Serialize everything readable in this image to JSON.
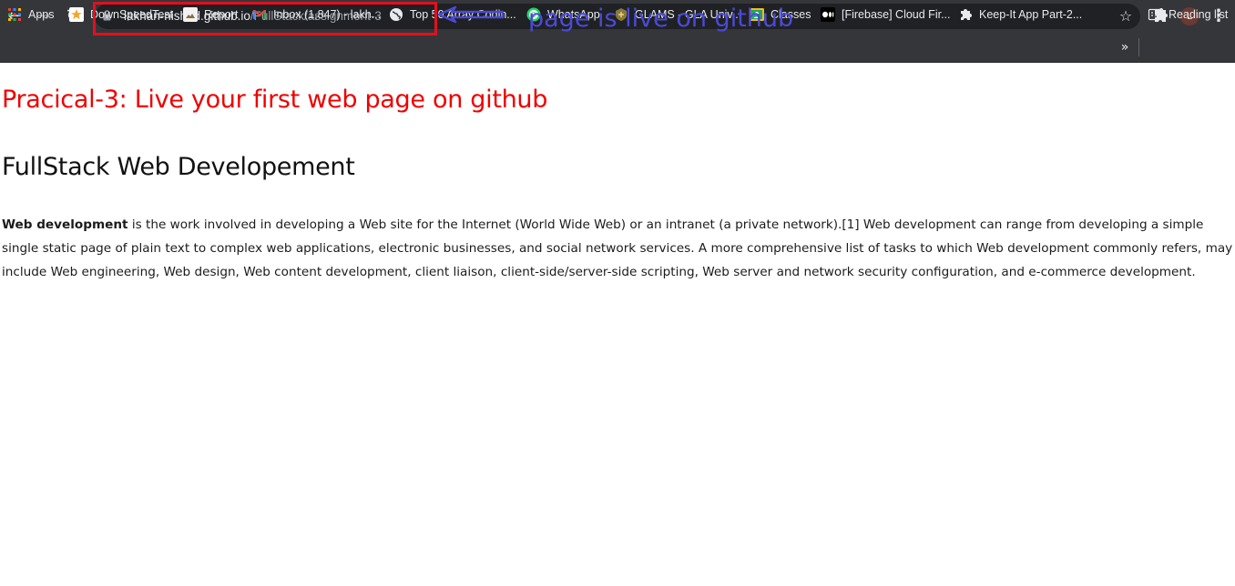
{
  "browser": {
    "url_host": "lakhan-nishad.github.io",
    "url_path": "/FullStack/assignment-3",
    "profile_initial": "L"
  },
  "bookmarks": [
    {
      "label": "Apps",
      "icon": "apps-grid-icon"
    },
    {
      "label": "DownSpeedTest",
      "icon": "downspeedtest-icon"
    },
    {
      "label": "Report",
      "icon": "report-icon"
    },
    {
      "label": "Inbox (1,847) - lakh...",
      "icon": "gmail-icon"
    },
    {
      "label": "Top 50 Array Codin...",
      "icon": "globe-icon"
    },
    {
      "label": "WhatsApp",
      "icon": "whatsapp-icon"
    },
    {
      "label": "GLAMS - GLA Univ...",
      "icon": "gla-icon"
    },
    {
      "label": "Classes",
      "icon": "classroom-icon"
    },
    {
      "label": "[Firebase] Cloud Fir...",
      "icon": "medium-icon"
    },
    {
      "label": "Keep-It App Part-2...",
      "icon": "puzzle-bookmark-icon"
    }
  ],
  "reading_list": "Reading list",
  "annotation": {
    "note": "page is live on github",
    "box_color": "#e1101f",
    "note_color": "#4a4ad6"
  },
  "page": {
    "heading": "Pracical-3: Live your first web page on github",
    "subheading": "FullStack Web Developement",
    "para_bold": "Web development",
    "para_text": " is the work involved in developing a Web site for the Internet (World Wide Web) or an intranet (a private network).[1] Web development can range from developing a simple single static page of plain text to complex web applications, electronic businesses, and social network services. A more comprehensive list of tasks to which Web development commonly refers, may include Web engineering, Web design, Web content development, client liaison, client-side/server-side scripting, Web server and network security configuration, and e-commerce development."
  },
  "colors": {
    "heading": "#ee0000",
    "toolbar": "#35363a",
    "omnibox": "#202124"
  }
}
